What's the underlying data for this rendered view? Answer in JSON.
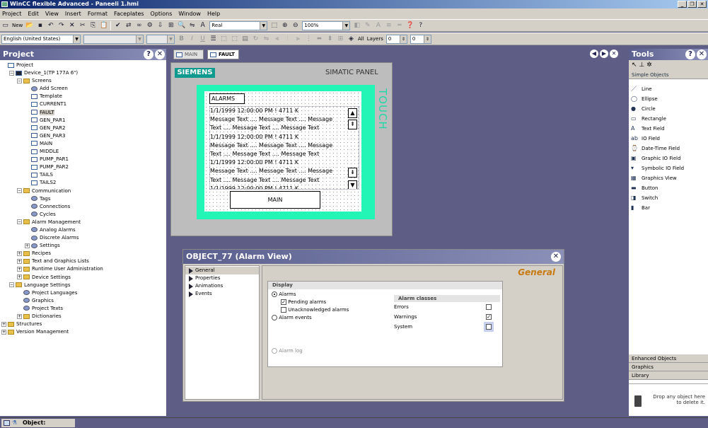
{
  "window": {
    "title": "WinCC flexible Advanced - Paneeli 1.hmi"
  },
  "menu": [
    "Project",
    "Edit",
    "View",
    "Insert",
    "Format",
    "Faceplates",
    "Options",
    "Window",
    "Help"
  ],
  "toolbar1": {
    "new_label": "New",
    "font_value": "Real",
    "zoom_value": "100%"
  },
  "toolbar2": {
    "language_value": "English (United States)",
    "all_label": "All",
    "layers_label": "Layers",
    "layer_value_1": "0",
    "layer_value_2": "0"
  },
  "project_panel": {
    "title": "Project",
    "tree": [
      {
        "label": "Project",
        "level": 0
      },
      {
        "label": "Device_1(TP 177A 6\")",
        "level": 1
      },
      {
        "label": "Screens",
        "level": 2
      },
      {
        "label": "Add Screen",
        "level": 3
      },
      {
        "label": "Template",
        "level": 3
      },
      {
        "label": "CURRENT1",
        "level": 3
      },
      {
        "label": "FAULT",
        "level": 3
      },
      {
        "label": "GEN_PAR1",
        "level": 3
      },
      {
        "label": "GEN_PAR2",
        "level": 3
      },
      {
        "label": "GEN_PAR3",
        "level": 3
      },
      {
        "label": "MAIN",
        "level": 3
      },
      {
        "label": "MIDDLE",
        "level": 3
      },
      {
        "label": "PUMP_PAR1",
        "level": 3
      },
      {
        "label": "PUMP_PAR2",
        "level": 3
      },
      {
        "label": "TAILS",
        "level": 3
      },
      {
        "label": "TAILS2",
        "level": 3
      },
      {
        "label": "Communication",
        "level": 2
      },
      {
        "label": "Tags",
        "level": 3
      },
      {
        "label": "Connections",
        "level": 3
      },
      {
        "label": "Cycles",
        "level": 3
      },
      {
        "label": "Alarm Management",
        "level": 2
      },
      {
        "label": "Analog Alarms",
        "level": 3
      },
      {
        "label": "Discrete Alarms",
        "level": 3
      },
      {
        "label": "Settings",
        "level": 3
      },
      {
        "label": "Recipes",
        "level": 2
      },
      {
        "label": "Text and Graphics Lists",
        "level": 2
      },
      {
        "label": "Runtime User Administration",
        "level": 2
      },
      {
        "label": "Device Settings",
        "level": 2
      },
      {
        "label": "Language Settings",
        "level": 1
      },
      {
        "label": "Project Languages",
        "level": 2
      },
      {
        "label": "Graphics",
        "level": 2
      },
      {
        "label": "Project Texts",
        "level": 2
      },
      {
        "label": "Dictionaries",
        "level": 2
      },
      {
        "label": "Structures",
        "level": 0
      },
      {
        "label": "Version Management",
        "level": 0
      }
    ]
  },
  "tabs": [
    {
      "label": "MAIN"
    },
    {
      "label": "FAULT"
    }
  ],
  "hmi_panel": {
    "brand": "SIEMENS",
    "model": "SIMATIC PANEL",
    "touch": "TOUCH",
    "alarms_label": "ALARMS",
    "alarm_lines": [
      "1/1/1999 12:00:00 PM ! 4711 K",
      "Message Text .... Message Text .... Message",
      "Text .... Message Text .... Message Text",
      "1/1/1999 12:00:00 PM ! 4711 K",
      "Message Text .... Message Text .... Message",
      "Text .... Message Text .... Message Text",
      "1/1/1999 12:00:00 PM ! 4711 K",
      "Message Text .... Message Text .... Message",
      "Text .... Message Text .... Message Text",
      "1/1/1999 12:00:00 PM ! 4711 K"
    ],
    "main_button": "MAIN"
  },
  "tools_panel": {
    "title": "Tools",
    "section": "Simple Objects",
    "items": [
      "Line",
      "Ellipse",
      "Circle",
      "Rectangle",
      "Text Field",
      "IO Field",
      "Date-Time Field",
      "Graphic IO Field",
      "Symbolic IO Field",
      "Graphics View",
      "Button",
      "Switch",
      "Bar"
    ],
    "bottom_sections": [
      "Enhanced Objects",
      "Graphics",
      "Library"
    ],
    "drop_hint": "Drop any object here to delete it."
  },
  "dialog": {
    "title": "OBJECT_77 (Alarm View)",
    "nav": [
      "General",
      "Properties",
      "Animations",
      "Events"
    ],
    "heading": "General",
    "display_label": "Display",
    "alarms_radio": "Alarms",
    "pending_alarms": "Pending alarms",
    "unack_alarms": "Unacknowledged alarms",
    "alarm_events": "Alarm events",
    "alarm_log": "Alarm log",
    "alarm_classes_header": "Alarm classes",
    "classes": [
      {
        "name": "Errors",
        "checked": false
      },
      {
        "name": "Warnings",
        "checked": true
      },
      {
        "name": "System",
        "checked": false
      }
    ]
  },
  "statusbar": {
    "object_label": "Object:"
  },
  "colors": {
    "panel_header": "#5a5f8e",
    "workspace": "#5d5d85",
    "hmi_green": "#22f5b6",
    "siemens_teal": "#0f9a8f",
    "dialog_heading": "#c87a10"
  }
}
